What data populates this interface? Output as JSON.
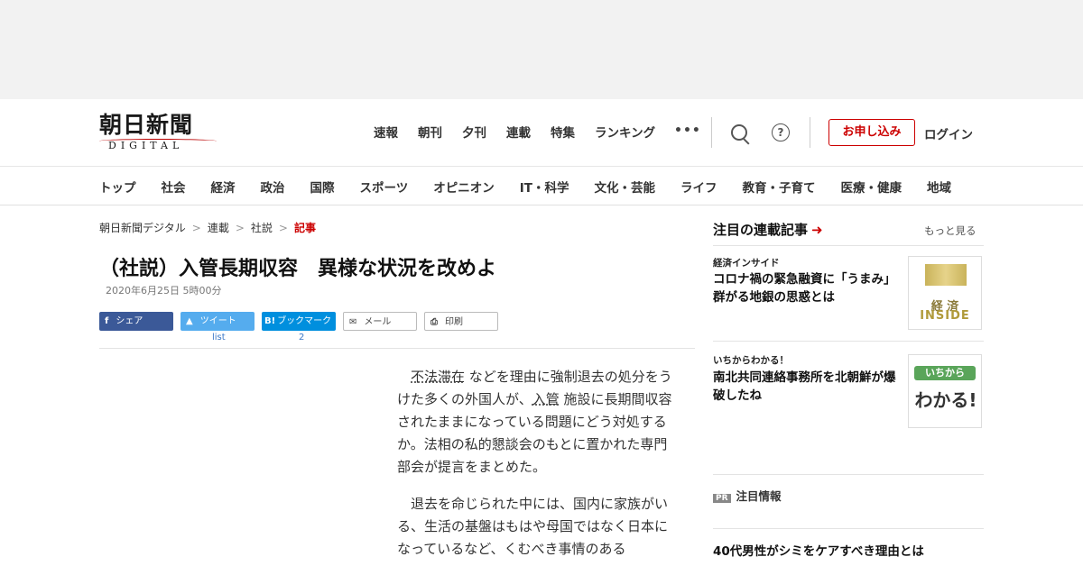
{
  "logo": {
    "jp": "朝日新聞",
    "en": "DIGITAL"
  },
  "topnav": [
    "速報",
    "朝刊",
    "夕刊",
    "連載",
    "特集",
    "ランキング"
  ],
  "header": {
    "subscribe": "お申し込み",
    "login": "ログイン",
    "more_icon": "•••"
  },
  "catnav": [
    "トップ",
    "社会",
    "経済",
    "政治",
    "国際",
    "スポーツ",
    "オピニオン",
    "IT・科学",
    "文化・芸能",
    "ライフ",
    "教育・子育て",
    "医療・健康",
    "地域"
  ],
  "breadcrumb": {
    "items": [
      "朝日新聞デジタル",
      "連載",
      "社説"
    ],
    "current": "記事",
    "sep": ">"
  },
  "article": {
    "title": "（社説）入管長期収容　異様な状況を改めよ",
    "date": "2020年6月25日 5時00分",
    "p1_a": "不法滞在",
    "p1_b": " などを理由に強制退去の処分をうけた多くの外国人が、",
    "p1_c": "入管",
    "p1_d": " 施設に長期間収容されたままになっている問題にどう対処するか。法相の私的懇談会のもとに置かれた専門部会が提言をまとめた。",
    "p2": "退去を命じられた中には、国内に家族がいる、生活の基盤はもはや母国ではなく日本になっているなど、くむべき事情のある"
  },
  "share": {
    "facebook": "シェア",
    "twitter": "ツイート",
    "twitter_count": "list",
    "hatena": "ブックマーク",
    "hatena_count": "2",
    "mail": "メール",
    "print": "印刷"
  },
  "sidebar": {
    "heading": "注目の連載記事",
    "more": "もっと見る",
    "items": [
      {
        "category": "経済インサイド",
        "title": "コロナ禍の緊急融資に「うまみ」　群がる地銀の思惑とは",
        "thumb_line1": "経 済",
        "thumb_line2": "INSIDE"
      },
      {
        "category": "いちからわかる！",
        "title": "南北共同連絡事務所を北朝鮮が爆破したね",
        "thumb_line1": "いちから",
        "thumb_line2": "わかる!"
      }
    ],
    "pr_badge": "PR",
    "pr_label": "注目情報",
    "pr_title": "40代男性がシミをケアすべき理由とは"
  }
}
